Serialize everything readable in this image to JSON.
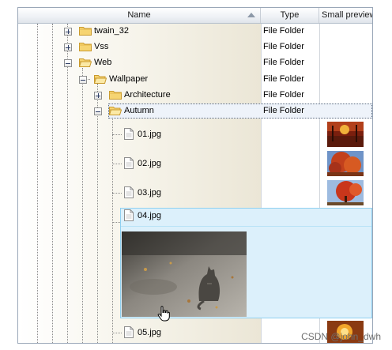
{
  "columns": {
    "name": "Name",
    "type": "Type",
    "preview": "Small preview"
  },
  "tree": {
    "rows": [
      {
        "label": "twain_32",
        "type": "File Folder",
        "expander": "plus"
      },
      {
        "label": "Vss",
        "type": "File Folder",
        "expander": "plus"
      },
      {
        "label": "Web",
        "type": "File Folder",
        "expander": "minus"
      },
      {
        "label": "Wallpaper",
        "type": "File Folder",
        "expander": "minus"
      },
      {
        "label": "Architecture",
        "type": "File Folder",
        "expander": "plus"
      },
      {
        "label": "Autumn",
        "type": "File Folder",
        "expander": "minus",
        "selected": true
      }
    ],
    "files": [
      {
        "label": "01.jpg",
        "preview": "autumn-park-thumbnail"
      },
      {
        "label": "02.jpg",
        "preview": "red-tree-thumbnail"
      },
      {
        "label": "03.jpg",
        "preview": "red-tree-sky-thumbnail"
      },
      {
        "label": "04.jpg",
        "preview": "cat-photo",
        "hovered": true
      },
      {
        "label": "05.jpg",
        "preview": "autumn-sun-thumbnail"
      }
    ]
  },
  "watermark": "CSDN @john_dwh",
  "colors": {
    "hover_fill": "#dcf0fb",
    "hover_border": "#8fd0f0",
    "header_bg": "#eef1f5",
    "tree_line": "#8b8b8b"
  }
}
